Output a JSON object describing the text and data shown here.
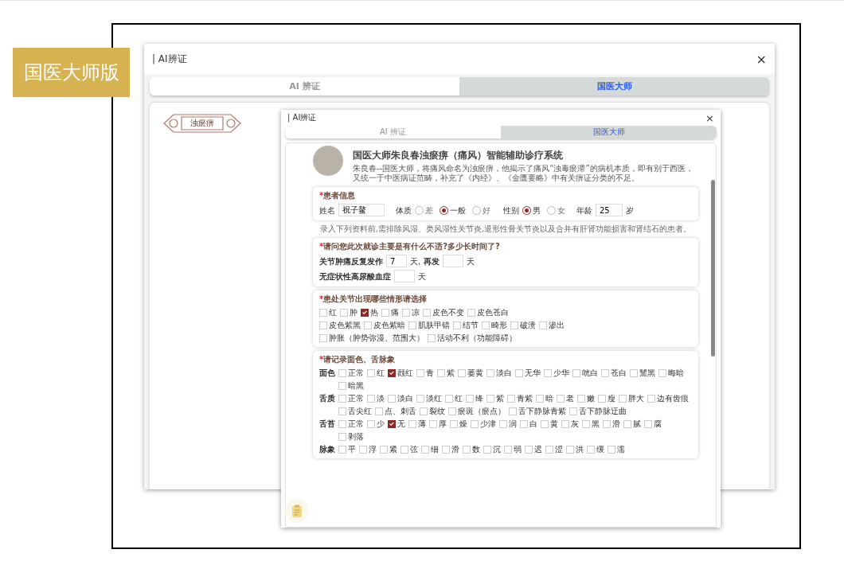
{
  "badge": "国医大师版",
  "outer_dialog": {
    "title": "| AI辨证",
    "close": "×",
    "tabs": [
      {
        "label": "AI 辨证",
        "selected": false
      },
      {
        "label": "国医大师",
        "selected": true
      }
    ],
    "disease_tag": "浊瘀痹"
  },
  "dialog": {
    "title": "| AI辨证",
    "close": "×",
    "tabs": [
      {
        "label": "AI 辨证",
        "selected": false
      },
      {
        "label": "国医大师",
        "selected": true
      }
    ],
    "intro": {
      "title": "国医大师朱良春浊瘀痹（痛风）智能辅助诊疗系统",
      "description": "朱良春--国医大师，将痛风命名为浊瘀痹，他揭示了痛风“浊毒瘀滞”的病机本质，即有别于西医，又统一于中医病证范畴，补充了《内经》、《金匮要略》中有关痹证分类的不足。"
    },
    "patient": {
      "required_mark": "*",
      "heading": "患者信息",
      "name_label": "姓名",
      "name": "祝子鳌",
      "constitution": {
        "label": "体质",
        "options": [
          {
            "label": "差",
            "selected": false
          },
          {
            "label": "一般",
            "selected": true
          },
          {
            "label": "好",
            "selected": false
          }
        ]
      },
      "sex": {
        "label": "性别",
        "options": [
          {
            "label": "男",
            "selected": true
          },
          {
            "label": "女",
            "selected": false
          }
        ]
      },
      "age": {
        "label": "年龄",
        "value": "25",
        "unit": "岁"
      }
    },
    "note": "录入下列资料前,需排除风湿、类风湿性关节炎,退形性骨关节炎以及合并有肝肾功能损害和肾结石的患者。",
    "complaint": {
      "required_mark": "*",
      "heading": "请问您此次就诊主要是有什么不适?多少长时间了?",
      "rows": [
        {
          "label": "关节肿痛反复发作",
          "fields": [
            {
              "value": "7",
              "unit": "天,"
            },
            {
              "prefix": "再发",
              "unit": "天"
            }
          ]
        },
        {
          "label": "无症状性高尿酸血症",
          "fields": [
            {
              "unit": "天"
            }
          ]
        }
      ]
    },
    "symptoms": {
      "required_mark": "*",
      "heading": "患处关节出现哪些情形请选择",
      "lines": [
        [
          {
            "label": "红",
            "checked": false
          },
          {
            "label": "肿",
            "checked": false
          },
          {
            "label": "热",
            "checked": true
          },
          {
            "label": "痛",
            "checked": false
          },
          {
            "label": "凉",
            "checked": false
          },
          {
            "label": "皮色不变",
            "checked": false
          },
          {
            "label": "皮色苍白",
            "checked": false
          }
        ],
        [
          {
            "label": "皮色紫黑",
            "checked": false
          },
          {
            "label": "皮色紫暗",
            "checked": false
          },
          {
            "label": "肌肤甲错",
            "checked": false
          },
          {
            "label": "结节",
            "checked": false
          },
          {
            "label": "畸形",
            "checked": false
          },
          {
            "label": "破溃",
            "checked": false
          },
          {
            "label": "渗出",
            "checked": false
          }
        ],
        [
          {
            "label": "肿胀（肿势弥漫、范围大）",
            "checked": false
          },
          {
            "label": "活动不利（功能障碍）",
            "checked": false
          }
        ]
      ]
    },
    "inspection": {
      "required_mark": "*",
      "heading": "请记录面色、舌脉象",
      "groups": [
        {
          "label": "面色",
          "items": [
            {
              "label": "正常",
              "checked": false
            },
            {
              "label": "红",
              "checked": false
            },
            {
              "label": "颧红",
              "checked": true
            },
            {
              "label": "青",
              "checked": false
            },
            {
              "label": "紫",
              "checked": false
            },
            {
              "label": "萎黄",
              "checked": false
            },
            {
              "label": "淡白",
              "checked": false
            },
            {
              "label": "无华",
              "checked": false
            },
            {
              "label": "少华",
              "checked": false
            },
            {
              "label": "㿠白",
              "checked": false
            },
            {
              "label": "苍白",
              "checked": false
            },
            {
              "label": "黧黑",
              "checked": false
            },
            {
              "label": "晦暗",
              "checked": false
            },
            {
              "label": "暗黑",
              "checked": false
            }
          ]
        },
        {
          "label": "舌质",
          "items": [
            {
              "label": "正常",
              "checked": false
            },
            {
              "label": "淡",
              "checked": false
            },
            {
              "label": "淡白",
              "checked": false
            },
            {
              "label": "淡红",
              "checked": false
            },
            {
              "label": "红",
              "checked": false
            },
            {
              "label": "绛",
              "checked": false
            },
            {
              "label": "紫",
              "checked": false
            },
            {
              "label": "青紫",
              "checked": false
            },
            {
              "label": "暗",
              "checked": false
            },
            {
              "label": "老",
              "checked": false
            },
            {
              "label": "嫩",
              "checked": false
            },
            {
              "label": "瘦",
              "checked": false
            },
            {
              "label": "胖大",
              "checked": false
            },
            {
              "label": "边有齿痕",
              "checked": false
            },
            {
              "label": "舌尖红",
              "checked": false
            },
            {
              "label": "点、刺舌",
              "checked": false
            },
            {
              "label": "裂纹",
              "checked": false
            },
            {
              "label": "瘀斑（瘀点）",
              "checked": false
            },
            {
              "label": "舌下静脉青紫",
              "checked": false
            },
            {
              "label": "舌下静脉迂曲",
              "checked": false
            }
          ]
        },
        {
          "label": "舌苔",
          "items": [
            {
              "label": "正常",
              "checked": false
            },
            {
              "label": "少",
              "checked": false
            },
            {
              "label": "无",
              "checked": true
            },
            {
              "label": "薄",
              "checked": false
            },
            {
              "label": "厚",
              "checked": false
            },
            {
              "label": "燥",
              "checked": false
            },
            {
              "label": "少津",
              "checked": false
            },
            {
              "label": "润",
              "checked": false
            },
            {
              "label": "白",
              "checked": false
            },
            {
              "label": "黄",
              "checked": false
            },
            {
              "label": "灰",
              "checked": false
            },
            {
              "label": "黑",
              "checked": false
            },
            {
              "label": "滑",
              "checked": false
            },
            {
              "label": "腻",
              "checked": false
            },
            {
              "label": "腐",
              "checked": false
            },
            {
              "label": "剥落",
              "checked": false
            }
          ]
        },
        {
          "label": "脉象",
          "items": [
            {
              "label": "平",
              "checked": false
            },
            {
              "label": "浮",
              "checked": false
            },
            {
              "label": "紧",
              "checked": false
            },
            {
              "label": "弦",
              "checked": false
            },
            {
              "label": "细",
              "checked": false
            },
            {
              "label": "滑",
              "checked": false
            },
            {
              "label": "数",
              "checked": false
            },
            {
              "label": "沉",
              "checked": false
            },
            {
              "label": "弱",
              "checked": false
            },
            {
              "label": "迟",
              "checked": false
            },
            {
              "label": "涩",
              "checked": false
            },
            {
              "label": "洪",
              "checked": false
            },
            {
              "label": "缓",
              "checked": false
            },
            {
              "label": "濡",
              "checked": false
            }
          ]
        }
      ]
    }
  }
}
